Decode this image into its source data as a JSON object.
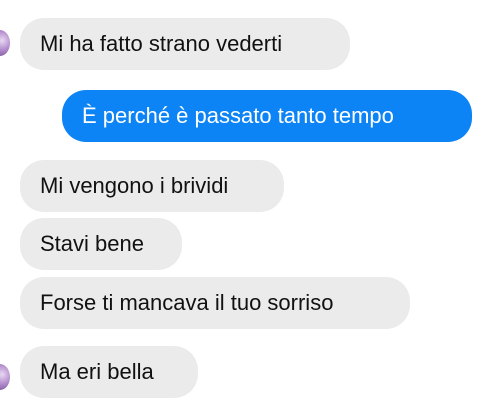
{
  "conversation": {
    "messages": [
      {
        "direction": "incoming",
        "text": "Mi ha fatto strano vederti"
      },
      {
        "direction": "outgoing",
        "text": "È perché è passato tanto tempo"
      },
      {
        "direction": "incoming",
        "text": "Mi vengono i brividi"
      },
      {
        "direction": "incoming",
        "text": "Stavi bene"
      },
      {
        "direction": "incoming",
        "text": "Forse ti mancava il tuo sorriso"
      },
      {
        "direction": "incoming",
        "text": "Ma eri bella"
      }
    ]
  },
  "colors": {
    "incoming_bubble": "#ebebeb",
    "outgoing_bubble": "#0d84f6",
    "incoming_text": "#111111",
    "outgoing_text": "#ffffff"
  }
}
